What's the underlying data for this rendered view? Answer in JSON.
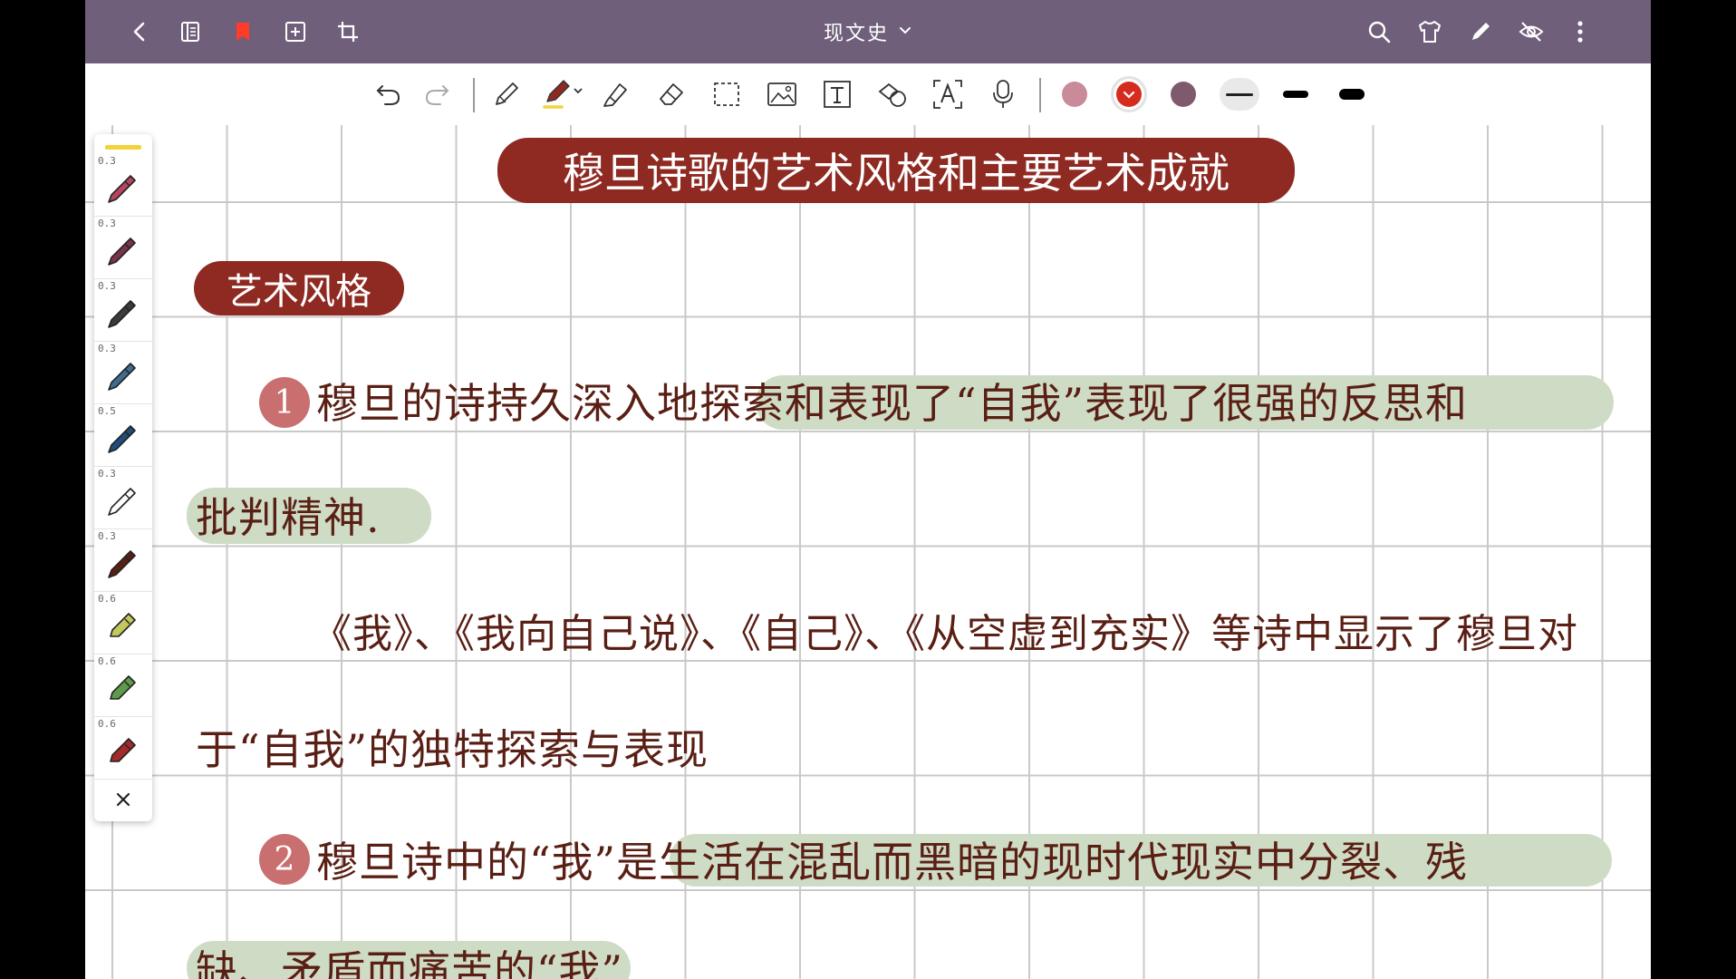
{
  "topbar": {
    "doc_title": "现文史",
    "bg_color": "#6f5f7b"
  },
  "toolbar": {
    "tools": [
      "undo-icon",
      "redo-icon",
      "pencil-icon",
      "pen-icon",
      "highlighter-icon",
      "eraser-icon",
      "lasso-select-icon",
      "image-icon",
      "text-icon",
      "shape-icon",
      "text-recognition-icon",
      "microphone-icon"
    ],
    "colors": [
      "#c98a9a",
      "#d62c1f",
      "#7f5a6d"
    ],
    "selected_color": "#d62c1f",
    "thicknesses": [
      "thin",
      "medium",
      "thick"
    ]
  },
  "pen_panel": {
    "highlight_color": "#f2d33a",
    "pens": [
      {
        "size": "0.3",
        "color": "#b8455f",
        "kind": "pen"
      },
      {
        "size": "0.3",
        "color": "#7a3348",
        "kind": "pen"
      },
      {
        "size": "0.3",
        "color": "#3b3b3b",
        "kind": "pen"
      },
      {
        "size": "0.3",
        "color": "#3e6e8f",
        "kind": "pen"
      },
      {
        "size": "0.5",
        "color": "#1d4f7a",
        "kind": "pen"
      },
      {
        "size": "0.3",
        "color": "#ffffff",
        "kind": "pen"
      },
      {
        "size": "0.3",
        "color": "#5a1f14",
        "kind": "pen"
      },
      {
        "size": "0.6",
        "color": "#c2c95c",
        "kind": "marker"
      },
      {
        "size": "0.6",
        "color": "#5f9a4a",
        "kind": "marker"
      },
      {
        "size": "0.6",
        "color": "#a32a2a",
        "kind": "marker"
      }
    ]
  },
  "note": {
    "title": "穆旦诗歌的艺术风格和主要艺术成就",
    "section": "艺术风格",
    "item1_number": "1",
    "line1": "穆旦的诗持久深入地探索和表现了“自我”表现了很强的反思和",
    "line2": "批判精神.",
    "line3": "《我》、《我向自己说》、《自己》、《从空虚到充实》等诗中显示了穆旦对",
    "line4": "于“自我”的独特探索与表现",
    "item2_number": "2",
    "line5": "穆旦诗中的“我”是生活在混乱而黑暗的现时代现实中分裂、残",
    "line6": "缺、矛盾而痛苦的“我”"
  }
}
